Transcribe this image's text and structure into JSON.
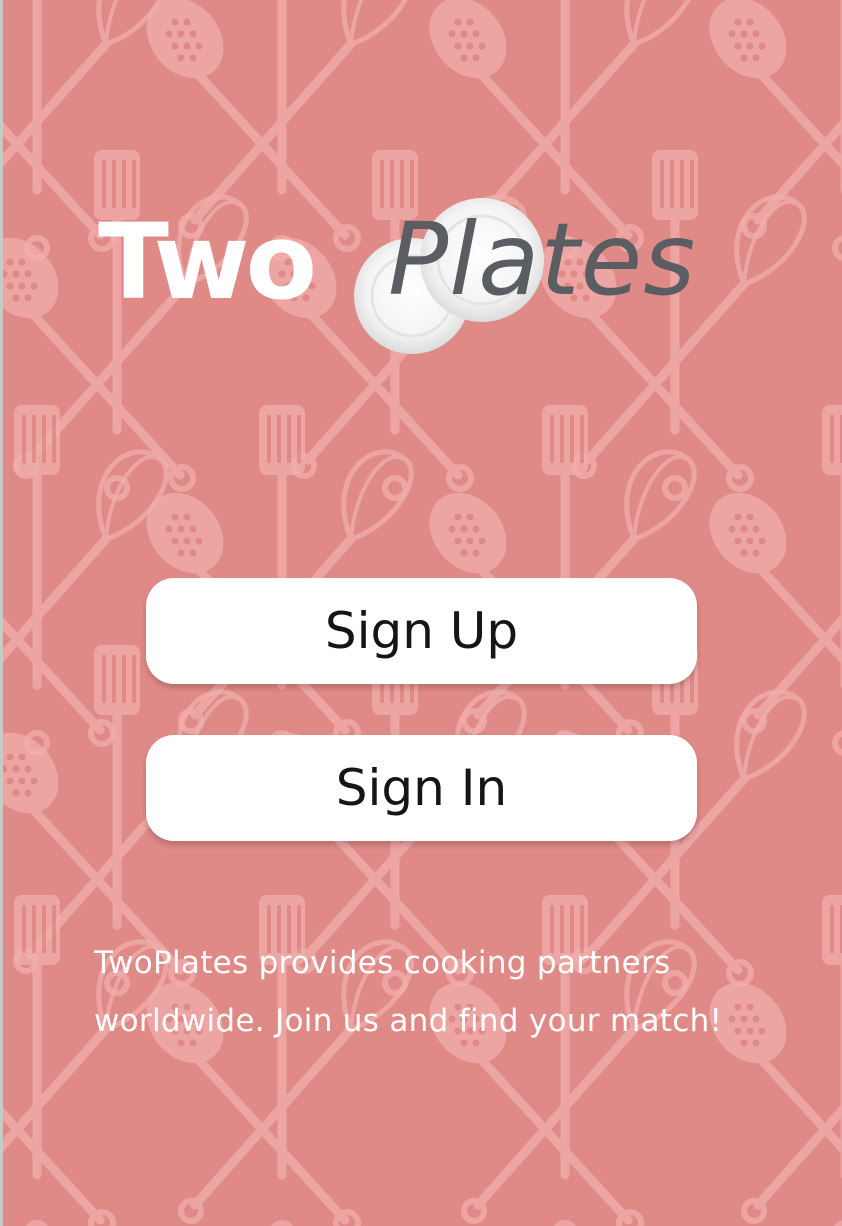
{
  "brand": {
    "logo_part1": "Two",
    "logo_part2": "Plates"
  },
  "buttons": {
    "sign_up_label": "Sign Up",
    "sign_in_label": "Sign In"
  },
  "tagline": {
    "line1": "TwoPlates provides cooking partners",
    "line2": "worldwide. Join us and find your match!"
  },
  "colors": {
    "background": "#e08a87",
    "pattern": "#f2b7b3",
    "button_bg": "#ffffff",
    "button_text": "#151515",
    "logo_two": "#ffffff",
    "logo_plates": "#5a5d61"
  },
  "icons": [
    "whisk-icon",
    "spatula-icon",
    "slotted-spoon-icon",
    "plate-icon"
  ]
}
